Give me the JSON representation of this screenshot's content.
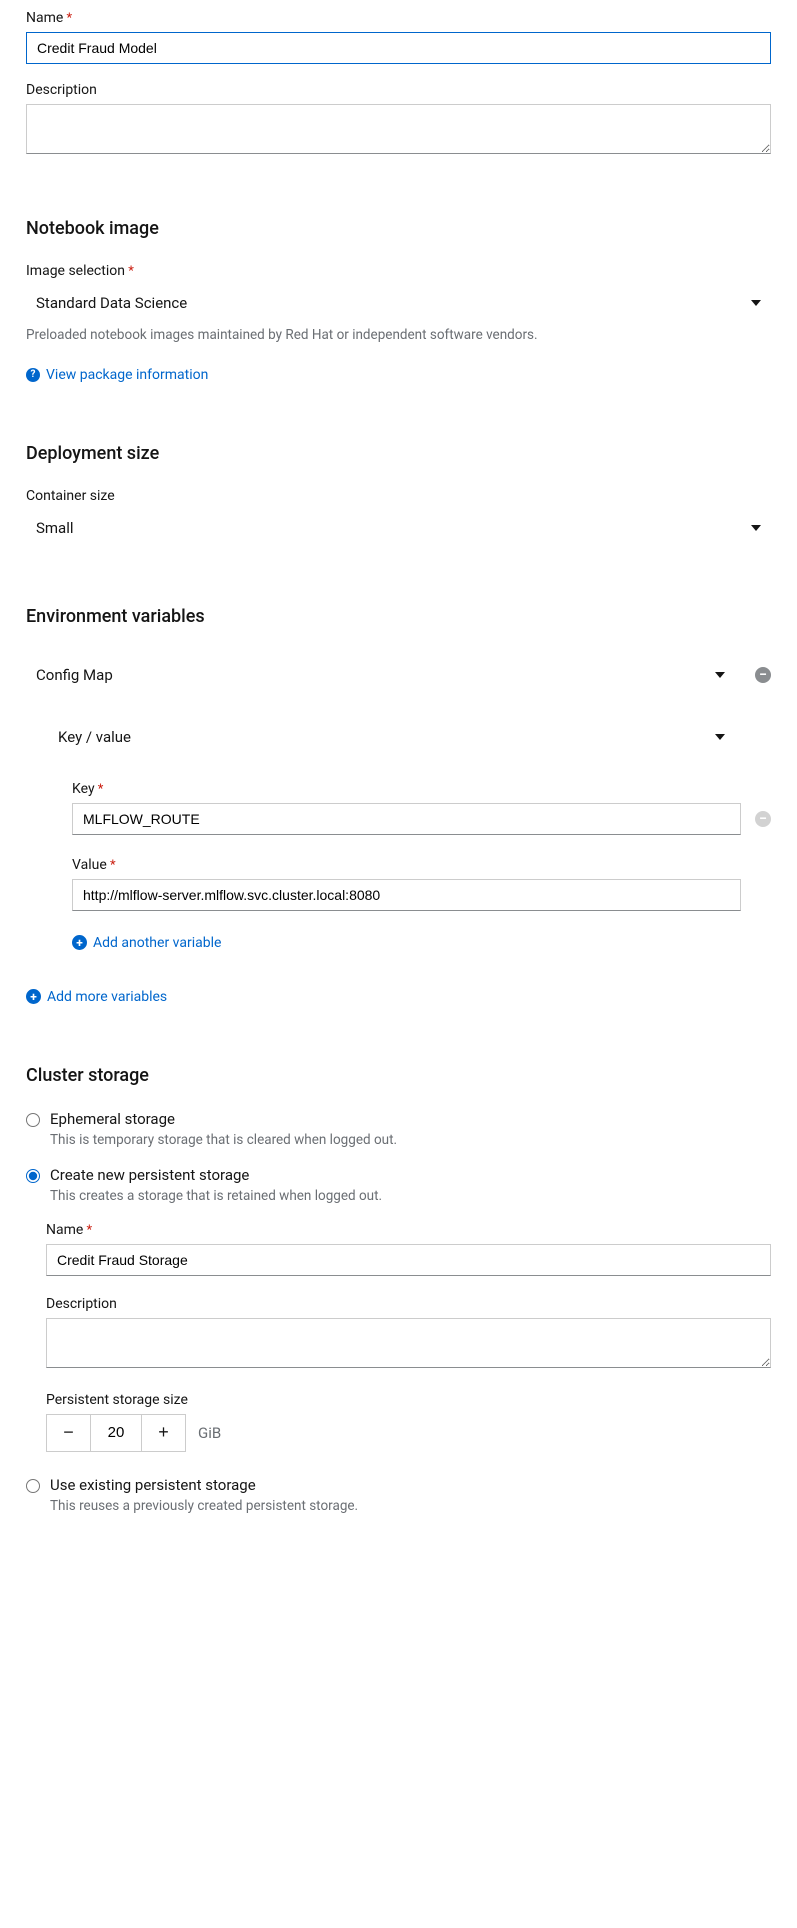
{
  "name_section": {
    "label": "Name",
    "value": "Credit Fraud Model",
    "desc_label": "Description",
    "desc_value": ""
  },
  "notebook_image": {
    "title": "Notebook image",
    "selection_label": "Image selection",
    "selection_value": "Standard Data Science",
    "help_text": "Preloaded notebook images maintained by Red Hat or independent software vendors.",
    "package_link": "View package information"
  },
  "deployment_size": {
    "title": "Deployment size",
    "label": "Container size",
    "value": "Small"
  },
  "env_vars": {
    "title": "Environment variables",
    "type_value": "Config Map",
    "subtype_value": "Key / value",
    "key_label": "Key",
    "key_value": "MLFLOW_ROUTE",
    "value_label": "Value",
    "value_value": "http://mlflow-server.mlflow.svc.cluster.local:8080",
    "add_another": "Add another variable",
    "add_more": "Add more variables"
  },
  "cluster_storage": {
    "title": "Cluster storage",
    "ephemeral": {
      "label": "Ephemeral storage",
      "help": "This is temporary storage that is cleared when logged out."
    },
    "create_new": {
      "label": "Create new persistent storage",
      "help": "This creates a storage that is retained when logged out.",
      "name_label": "Name",
      "name_value": "Credit Fraud Storage",
      "desc_label": "Description",
      "desc_value": "",
      "size_label": "Persistent storage size",
      "size_value": "20",
      "size_unit": "GiB"
    },
    "existing": {
      "label": "Use existing persistent storage",
      "help": "This reuses a previously created persistent storage."
    }
  }
}
